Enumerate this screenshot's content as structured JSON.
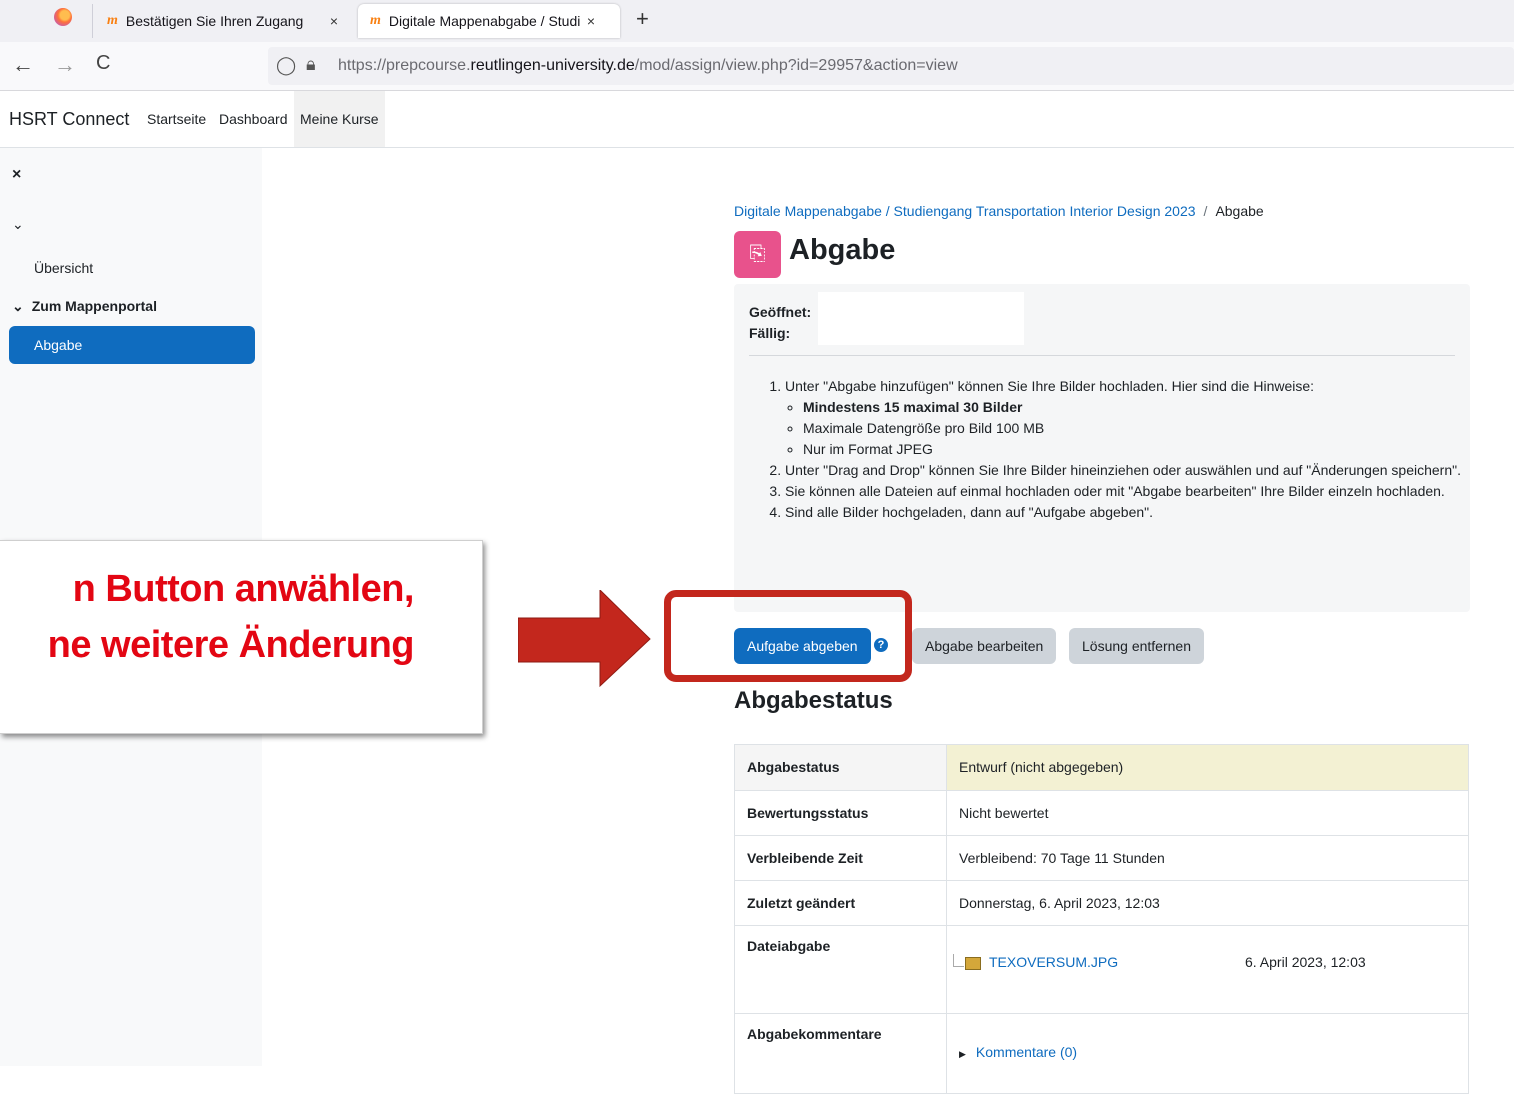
{
  "browser": {
    "tabs": [
      {
        "label": "Bestätigen Sie Ihren Zugang",
        "close": "×"
      },
      {
        "label": "Digitale Mappenabgabe / Studi",
        "close": "×"
      }
    ],
    "new_tab": "+",
    "nav": {
      "back": "←",
      "forward": "→",
      "reload": "C"
    },
    "url_prefix": "https://prepcourse.",
    "url_domain": "reutlingen-university.de",
    "url_path": "/mod/assign/view.php?id=29957&action=view"
  },
  "navbar": {
    "brand": "HSRT Connect",
    "links": [
      "Startseite",
      "Dashboard",
      "Meine Kurse"
    ]
  },
  "drawer": {
    "close": "×",
    "items": [
      "Übersicht"
    ],
    "section": "Zum Mappenportal",
    "active": "Abgabe"
  },
  "breadcrumb": {
    "course": "Digitale Mappenabgabe / Studiengang Transportation Interior Design 2023",
    "separator": "/",
    "current": "Abgabe"
  },
  "page": {
    "title": "Abgabe",
    "opened_label": "Geöffnet:",
    "due_label": "Fällig:"
  },
  "instructions": {
    "step1": "Unter \"Abgabe hinzufügen\" können Sie Ihre Bilder hochladen. Hier sind die Hinweise:",
    "hints": [
      "Mindestens 15 maximal 30 Bilder",
      "Maximale Datengröße pro Bild 100 MB",
      "Nur im Format JPEG"
    ],
    "step2": "Unter \"Drag and Drop\" können Sie Ihre Bilder hineinziehen oder auswählen und auf \"Änderungen speichern\".",
    "step3": "Sie können alle Dateien auf einmal hochladen oder mit \"Abgabe bearbeiten\" Ihre Bilder einzeln hochladen.",
    "step4": "Sind alle Bilder hochgeladen, dann auf \"Aufgabe abgeben\"."
  },
  "buttons": {
    "submit": "Aufgabe abgeben",
    "help": "?",
    "edit": "Abgabe bearbeiten",
    "remove": "Lösung entfernen"
  },
  "status": {
    "title": "Abgabestatus",
    "rows": [
      {
        "key": "Abgabestatus",
        "value": "Entwurf (nicht abgegeben)"
      },
      {
        "key": "Bewertungsstatus",
        "value": "Nicht bewertet"
      },
      {
        "key": "Verbleibende Zeit",
        "value": "Verbleibend: 70 Tage 11 Stunden"
      },
      {
        "key": "Zuletzt geändert",
        "value": "Donnerstag, 6. April 2023, 12:03"
      },
      {
        "key": "Dateiabgabe",
        "file": "TEXOVERSUM.JPG",
        "file_date": "6. April 2023, 12:03"
      },
      {
        "key": "Abgabekommentare",
        "value": "Kommentare (0)"
      }
    ]
  },
  "annotation": {
    "line1": "n Button anwählen,",
    "line2": "ne weitere Änderung",
    "color": "#e30613",
    "arrow_color": "#c3271d"
  }
}
